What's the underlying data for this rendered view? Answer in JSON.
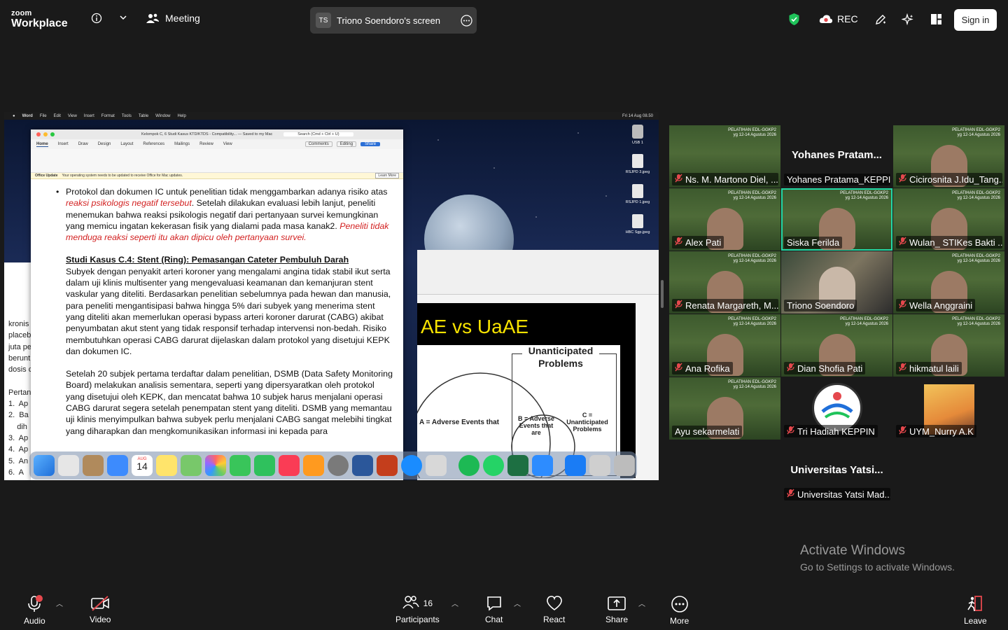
{
  "topbar": {
    "logo_line1": "zoom",
    "logo_line2": "Workplace",
    "meeting_label": "Meeting",
    "screen_initials": "TS",
    "screen_label": "Triono Soendoro's screen",
    "rec_label": "REC",
    "signin_label": "Sign in"
  },
  "shared": {
    "menubar": [
      "Word",
      "File",
      "Edit",
      "View",
      "Insert",
      "Format",
      "Tools",
      "Table",
      "Window",
      "Help"
    ],
    "clock": "Fri 14 Aug 08.50",
    "desktop_icons": [
      "USB 1",
      "RSJPD 3.jpeg",
      "RSJPD 1.jpeg",
      "HBC Sgp.jpeg"
    ],
    "word_title": "Kelompok C, 6 Studi Kasus KTD/KTDS - Compatibility... — Saved to my Mac",
    "word_search": "Search (Cmd + Ctrl + U)",
    "word_tabs": [
      "Home",
      "Insert",
      "Draw",
      "Design",
      "Layout",
      "References",
      "Mailings",
      "Review",
      "View"
    ],
    "comments_label": "Comments",
    "editing_label": "Editing",
    "share_label": "Share",
    "notice_title": "Office Update",
    "notice_text": "Your operating system needs to be updated to receive Office for Mac updates.",
    "learn_more": "Learn More",
    "para1_a": "Protokol dan dokumen IC untuk penelitian tidak menggambarkan adanya risiko atas ",
    "para1_red": "reaksi psikologis negatif tersebut",
    "para1_b": ". Setelah dilakukan evaluasi lebih lanjut, peneliti menemukan bahwa reaksi psikologis negatif dari pertanyaan survei kemungkinan yang memicu ingatan kekerasan fisik yang dialami pada masa kanak2. ",
    "para1_red2": "Peneliti tidak menduga reaksi seperti itu akan dipicu oleh pertanyaan survei.",
    "heading": "Studi Kasus C.4: Stent (Ring): Pemasangan Cateter Pembuluh Darah",
    "para2": "Subyek dengan penyakit arteri koroner yang mengalami angina tidak stabil ikut serta dalam uji klinis multisenter yang mengevaluasi keamanan dan kemanjuran stent vaskular yang diteliti. Berdasarkan penelitian sebelumnya pada hewan dan manusia, para peneliti mengantisipasi bahwa hingga 5% dari subyek yang menerima stent yang diteliti akan memerlukan operasi bypass arteri koroner darurat (CABG) akibat penyumbatan akut stent yang tidak responsif terhadap intervensi non-bedah. Risiko membutuhkan operasi CABG darurat dijelaskan dalam protokol yang disetujui KEPK dan dokumen IC.",
    "para3": "Setelah 20 subjek pertama terdaftar dalam penelitian, DSMB (Data Safety Monitoring Board) melakukan analisis sementara, seperti yang dipersyaratkan oleh protokol yang disetujui oleh KEPK, dan mencatat bahwa 10 subjek harus menjalani operasi CABG darurat segera setelah penempatan stent yang diteliti. DSMB yang memantau uji klinis menyimpulkan bahwa subyek perlu menjalani CABG sangat melebihi tingkat yang diharapkan dan mengkomunikasikan informasi ini kepada para",
    "behind_doc": [
      "kronis",
      "placeb",
      "juta pe",
      "berunt",
      "dosis c",
      "",
      "Pertan",
      "1.  Ap",
      "2.  Ba",
      "    dih",
      "3.  Ap",
      "4.  Ap",
      "5.  An",
      "6.  A",
      "    p"
    ],
    "slide_title": "AE vs UaAE",
    "slide_box_label": "Unanticipated Problems",
    "slide_a": "A = Adverse Events that",
    "slide_b": "B = Adverse Events that are",
    "slide_c": "C = Unanticipated Problems",
    "dock_date_month": "AUG",
    "dock_date_day": "14"
  },
  "participants": [
    {
      "name": "Ns. M. Martono Diel, ...",
      "muted": true,
      "video": "banner"
    },
    {
      "name": "Yohanes Pratama_KEPPIN",
      "muted": false,
      "video": "none",
      "big": "Yohanes  Pratam..."
    },
    {
      "name": "Cicirosnita J.Idu_Tang...",
      "muted": true,
      "video": "banner"
    },
    {
      "name": "Alex  Pati",
      "muted": true,
      "video": "banner"
    },
    {
      "name": "Siska Ferilda",
      "muted": false,
      "video": "banner",
      "active": true
    },
    {
      "name": "Wulan_ STIKes Bakti ...",
      "muted": true,
      "video": "banner"
    },
    {
      "name": "Renata Margareth, M...",
      "muted": true,
      "video": "banner"
    },
    {
      "name": "Triono Soendoro",
      "muted": false,
      "video": "room"
    },
    {
      "name": "Wella Anggraini",
      "muted": true,
      "video": "banner"
    },
    {
      "name": "Ana Rofika",
      "muted": true,
      "video": "banner"
    },
    {
      "name": "Dian Shofia Pati",
      "muted": true,
      "video": "banner"
    },
    {
      "name": "hikmatul laili",
      "muted": true,
      "video": "banner"
    },
    {
      "name": "Ayu sekarmelati",
      "muted": false,
      "video": "banner"
    },
    {
      "name": "Tri Hadiah KEPPIN",
      "muted": true,
      "video": "logo"
    },
    {
      "name": "UYM_Nurry A.K",
      "muted": true,
      "video": "photo"
    },
    {
      "name": "Universitas Yatsi Mad...",
      "muted": true,
      "video": "none",
      "big": "Universitas  Yatsi..."
    }
  ],
  "banner_text": "PELATIHAN EDL-GGKP2\nyg 12-14 Agustus 2026",
  "activate": {
    "title": "Activate Windows",
    "subtitle": "Go to Settings to activate Windows."
  },
  "bottombar": {
    "audio": "Audio",
    "video": "Video",
    "participants": "Participants",
    "participants_count": "16",
    "chat": "Chat",
    "react": "React",
    "share": "Share",
    "more": "More",
    "leave": "Leave",
    "audio_badge": "1"
  },
  "colors": {
    "active_speaker": "#23d9a5",
    "shield": "#1fc35a",
    "muted_red": "#e5484d"
  }
}
